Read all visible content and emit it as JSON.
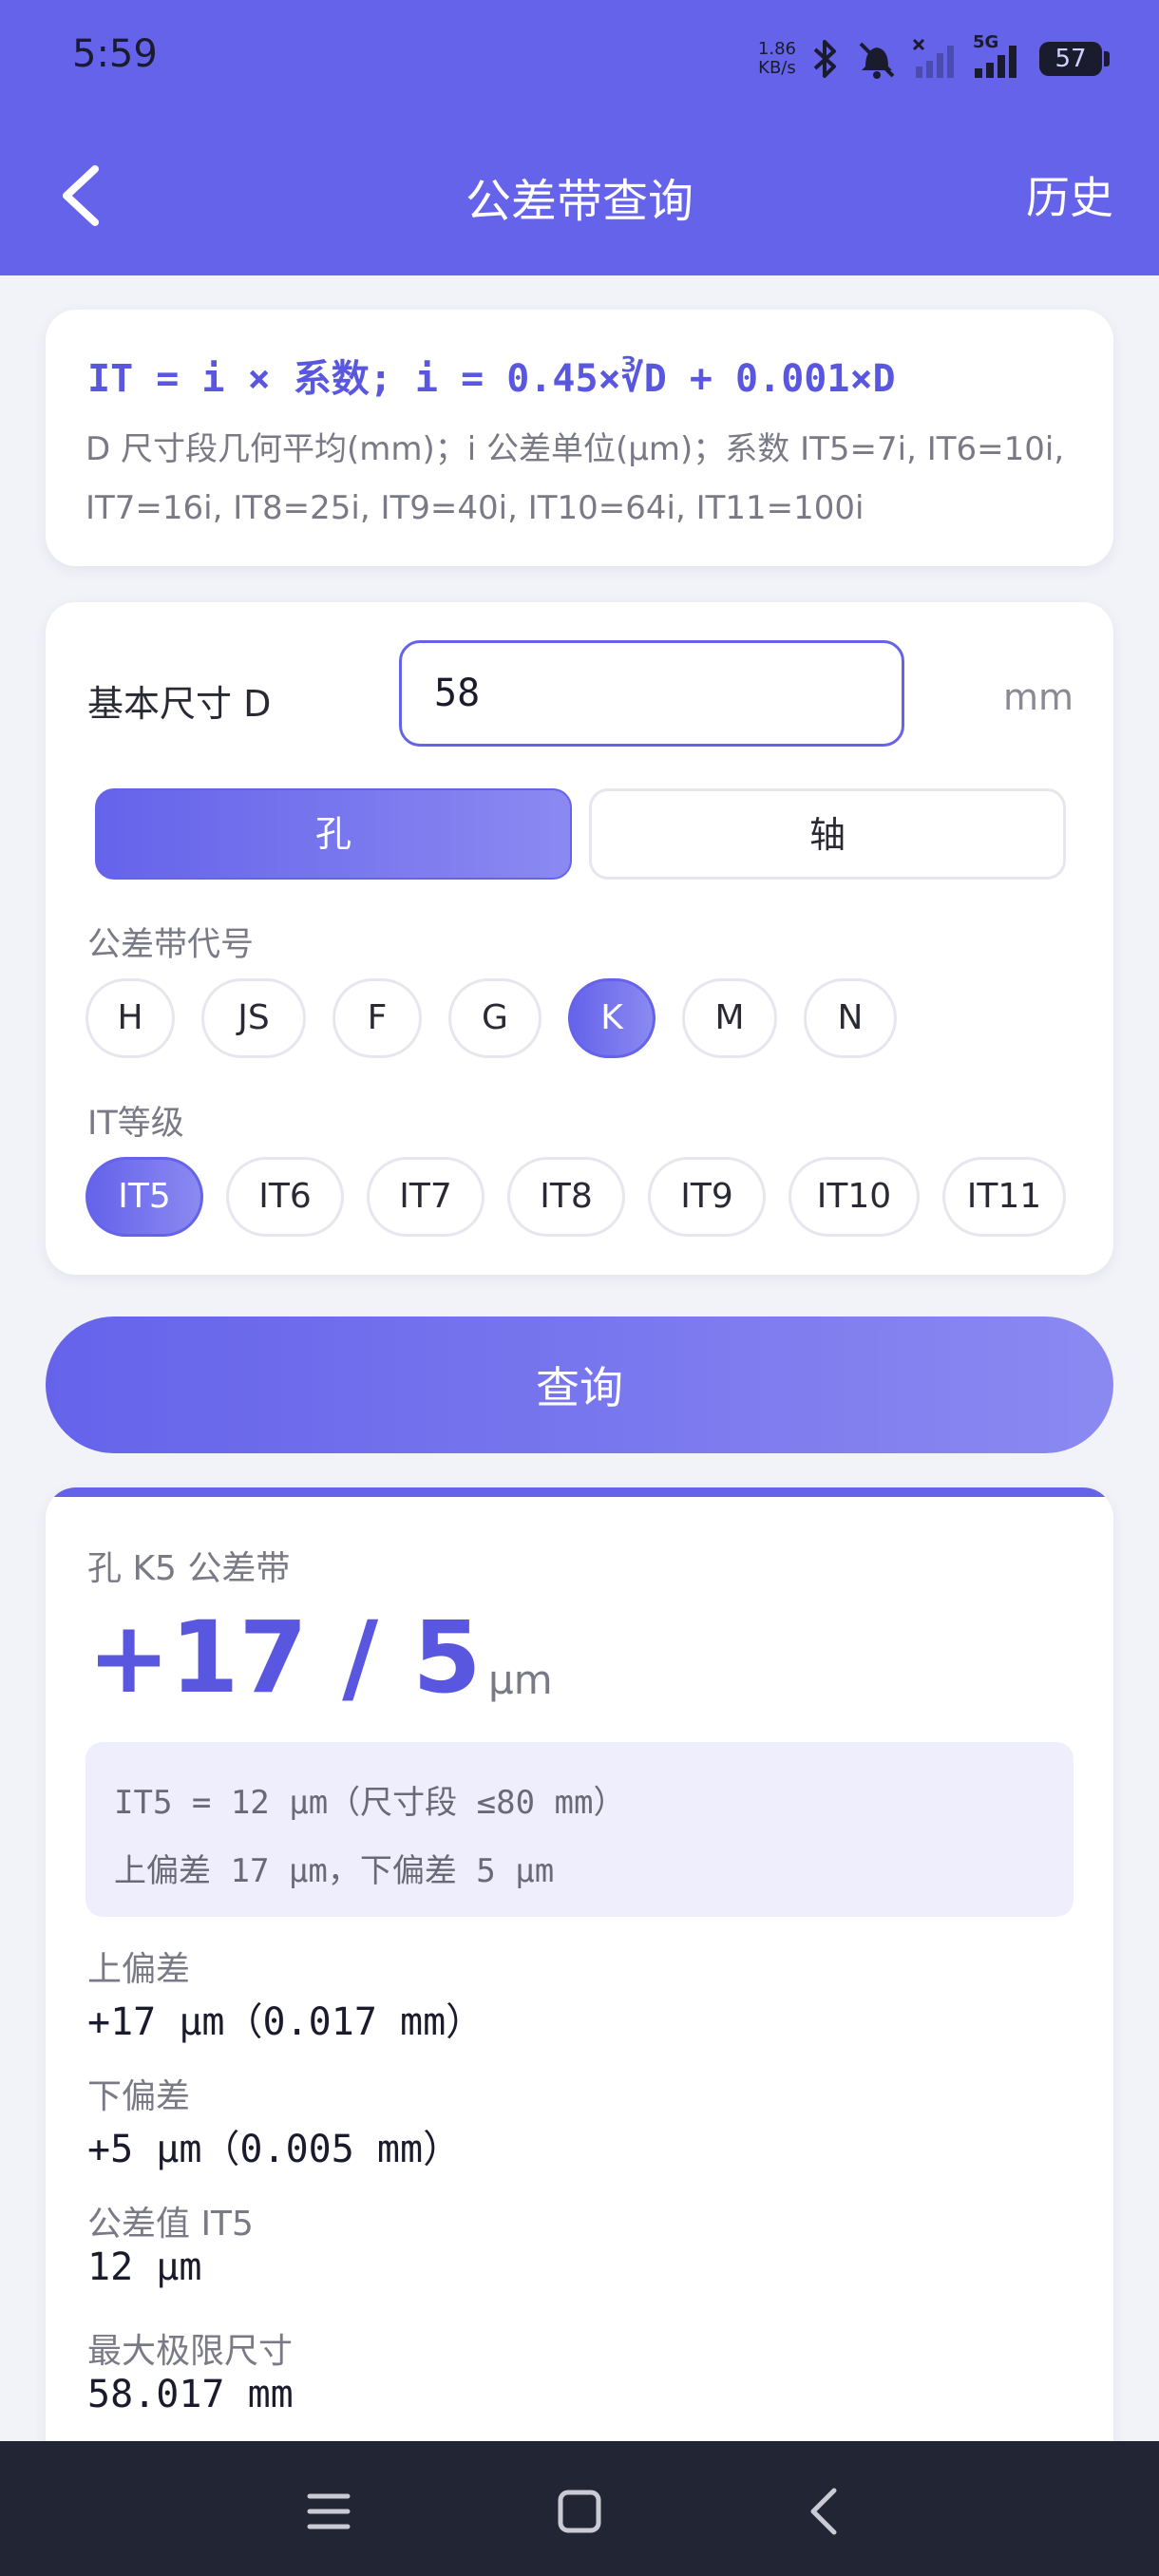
{
  "status": {
    "time": "5:59",
    "net_speed_value": "1.86",
    "net_speed_unit": "KB/s",
    "network": "5G",
    "battery": "57"
  },
  "header": {
    "title": "公差带查询",
    "history": "历史"
  },
  "formula": {
    "main": "IT = i × 系数; i = 0.45×∛D + 0.001×D",
    "note": "D 尺寸段几何平均(mm)；i 公差单位(μm)；系数 IT5=7i, IT6=10i, IT7=16i, IT8=25i, IT9=40i, IT10=64i, IT11=100i"
  },
  "input": {
    "label": "基本尺寸 D",
    "value": "58",
    "unit": "mm",
    "segments": [
      {
        "label": "孔",
        "active": true
      },
      {
        "label": "轴",
        "active": false
      }
    ],
    "zone_label": "公差带代号",
    "zones": [
      {
        "label": "H",
        "active": false
      },
      {
        "label": "JS",
        "active": false
      },
      {
        "label": "F",
        "active": false
      },
      {
        "label": "G",
        "active": false
      },
      {
        "label": "K",
        "active": true
      },
      {
        "label": "M",
        "active": false
      },
      {
        "label": "N",
        "active": false
      }
    ],
    "grade_label": "IT等级",
    "grades": [
      {
        "label": "IT5",
        "active": true
      },
      {
        "label": "IT6",
        "active": false
      },
      {
        "label": "IT7",
        "active": false
      },
      {
        "label": "IT8",
        "active": false
      },
      {
        "label": "IT9",
        "active": false
      },
      {
        "label": "IT10",
        "active": false
      },
      {
        "label": "IT11",
        "active": false
      }
    ]
  },
  "query_label": "查询",
  "result": {
    "title": "孔 K5 公差带",
    "value": "+17 / 5",
    "unit": "μm",
    "info_line1": "IT5 = 12 μm（尺寸段 ≤80 mm）",
    "info_line2": "上偏差 17 μm，下偏差 5 μm",
    "rows": [
      {
        "label": "上偏差",
        "value": "+17 μm（0.017 mm）"
      },
      {
        "label": "下偏差",
        "value": "+5 μm（0.005 mm）"
      },
      {
        "label": "公差值 IT5",
        "value": "12 μm"
      },
      {
        "label": "最大极限尺寸",
        "value": "58.017 mm"
      }
    ]
  }
}
